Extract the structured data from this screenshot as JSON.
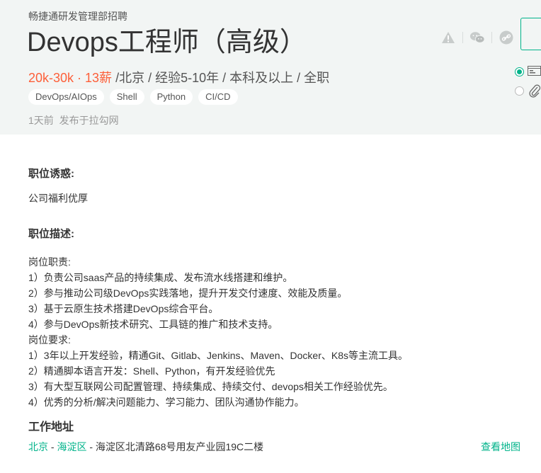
{
  "header": {
    "company": "畅捷通研发管理部招聘",
    "title": "Devops工程师（高级）",
    "salary": "20k-30k · 13薪",
    "meta_rest": " /北京 / 经验5-10年 / 本科及以上 / 全职",
    "tags": [
      "DevOps/AIOps",
      "Shell",
      "Python",
      "CI/CD"
    ],
    "publish_time": "1天前",
    "publish_source": "发布于拉勾网"
  },
  "icons": [
    "warning-icon",
    "wechat-icon",
    "link-icon"
  ],
  "sections": {
    "perks_title": "职位诱惑:",
    "perks_text": "公司福利优厚",
    "desc_title": "职位描述:",
    "desc_lines": [
      "岗位职责:",
      "1）负责公司saas产品的持续集成、发布流水线搭建和维护。",
      "2）参与推动公司级DevOps实践落地，提升开发交付速度、效能及质量。",
      "3）基于云原生技术搭建DevOps综合平台。",
      "4）参与DevOps新技术研究、工具链的推广和技术支持。",
      "岗位要求:",
      "1）3年以上开发经验，精通Git、Gitlab、Jenkins、Maven、Docker、K8s等主流工具。",
      "2）精通脚本语言开发：Shell、Python，有开发经验优先",
      "3）有大型互联网公司配置管理、持续集成、持续交付、devops相关工作经验优先。",
      "4）优秀的分析/解决问题能力、学习能力、团队沟通协作能力。"
    ],
    "address_title": "工作地址"
  },
  "address": {
    "city": "北京",
    "sep1": " - ",
    "district": "海淀区",
    "sep2": " - ",
    "detail": "海淀区北清路68号用友产业园19C二楼",
    "map_link": "查看地图"
  },
  "colors": {
    "accent": "#00b38a",
    "salary": "#fd5f39"
  }
}
